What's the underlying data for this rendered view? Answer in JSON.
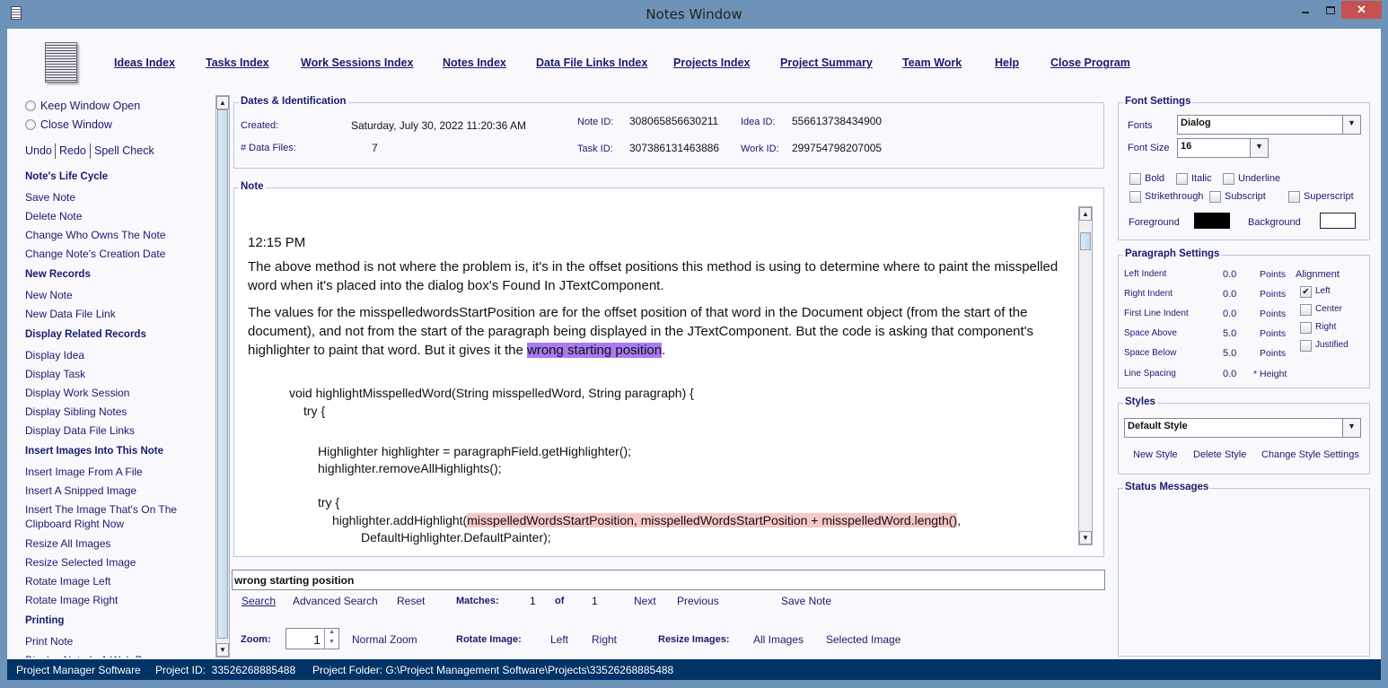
{
  "window": {
    "title": "Notes Window",
    "minimize_icon": "minimize-icon",
    "maximize_icon": "maximize-icon",
    "close_icon": "close-icon",
    "close_color": "#c75050"
  },
  "nav": [
    "Ideas Index",
    "Tasks Index",
    "Work Sessions Index",
    "Notes Index",
    "Data File Links Index",
    "Projects Index",
    "Project Summary",
    "Team Work",
    "Help",
    "Close Program"
  ],
  "sidebar": {
    "radios": [
      "Keep Window Open",
      "Close Window"
    ],
    "edit": [
      "Undo",
      "Redo",
      "Spell Check"
    ],
    "sections": [
      {
        "title": "Note's Life Cycle",
        "items": [
          "Save Note",
          "Delete Note",
          "Change Who Owns The Note",
          "Change Note's Creation Date"
        ]
      },
      {
        "title": "New Records",
        "items": [
          "New Note",
          "New Data File Link"
        ]
      },
      {
        "title": "Display Related Records",
        "items": [
          "Display Idea",
          "Display Task",
          "Display Work Session",
          "Display Sibling Notes",
          "Display Data File Links"
        ]
      },
      {
        "title": "Insert Images Into This Note",
        "items": [
          "Insert Image From A File",
          "Insert A Snipped Image",
          "Insert The Image That's On The Clipboard Right Now",
          "Resize All Images",
          "Resize Selected Image",
          "Rotate Image Left",
          "Rotate Image Right"
        ]
      },
      {
        "title": "Printing",
        "items": [
          "Print Note",
          "Display Note In A Web Page"
        ]
      }
    ]
  },
  "dates": {
    "title": "Dates & Identification",
    "created_label": "Created:",
    "created": "Saturday, July 30, 2022   11:20:36 AM",
    "files_label": "# Data Files:",
    "files": "7",
    "note_id_label": "Note ID:",
    "note_id": "308065856630211",
    "idea_id_label": "Idea ID:",
    "idea_id": "556613738434900",
    "task_id_label": "Task ID:",
    "task_id": "307386131463886",
    "work_id_label": "Work ID:",
    "work_id": "299754798207005"
  },
  "note": {
    "title": "Note",
    "time": "12:15 PM",
    "p1": "The above method is not where the problem is, it's in the offset positions this method is using to determine where to paint the misspelled word when it's placed into the dialog box's Found In JTextComponent.",
    "p2a": "The values for the misspelledwordsStartPosition are for the offset position of that word in the Document object (from the start of the document), and not from the start of the paragraph being displayed in the JTextComponent. But the code is  asking that component's highlighter to paint that word. But it gives it the ",
    "p2hl": "wrong starting position",
    "p2b": ".",
    "code": [
      "void highlightMisspelledWord(String misspelledWord, String paragraph) {",
      "try {",
      "Highlighter highlighter = paragraphField.getHighlighter();",
      "highlighter.removeAllHighlights();",
      "try {",
      "highlighter.addHighlight(",
      "misspelledWordsStartPosition, misspelledWordsStartPosition + misspelledWord.length()",
      ",",
      "DefaultHighlighter.DefaultPainter);"
    ],
    "highlight_color": "#a87cf0",
    "code_highlight_color": "#f8c8c8"
  },
  "search": {
    "value": "wrong starting position",
    "search": "Search",
    "advanced": "Advanced Search",
    "reset": "Reset",
    "matches_label": "Matches:",
    "match": "1",
    "of": "of",
    "total": "1",
    "next": "Next",
    "previous": "Previous",
    "save": "Save Note"
  },
  "bottom": {
    "zoom_label": "Zoom:",
    "zoom": "1",
    "normal_zoom": "Normal Zoom",
    "rotate_label": "Rotate Image:",
    "left": "Left",
    "right": "Right",
    "resize_label": "Resize Images:",
    "all": "All Images",
    "selected": "Selected Image"
  },
  "font": {
    "title": "Font Settings",
    "fonts_label": "Fonts",
    "font": "Dialog",
    "size_label": "Font Size",
    "size": "16",
    "checks": [
      "Bold",
      "Italic",
      "Underline",
      "Strikethrough",
      "Subscript",
      "Superscript"
    ],
    "fg_label": "Foreground",
    "bg_label": "Background",
    "fg": "#000000",
    "bg": "#ffffff"
  },
  "para": {
    "title": "Paragraph Settings",
    "rows": [
      {
        "label": "Left Indent",
        "value": "0.0",
        "unit": "Points"
      },
      {
        "label": "Right Indent",
        "value": "0.0",
        "unit": "Points"
      },
      {
        "label": "First Line Indent",
        "value": "0.0",
        "unit": "Points"
      },
      {
        "label": "Space Above",
        "value": "5.0",
        "unit": "Points"
      },
      {
        "label": "Space Below",
        "value": "5.0",
        "unit": "Points"
      },
      {
        "label": "Line Spacing",
        "value": "0.0",
        "unit": "* Height"
      }
    ],
    "align_label": "Alignment",
    "align": [
      {
        "label": "Left",
        "checked": true
      },
      {
        "label": "Center",
        "checked": false
      },
      {
        "label": "Right",
        "checked": false
      },
      {
        "label": "Justified",
        "checked": false
      }
    ]
  },
  "styles": {
    "title": "Styles",
    "value": "Default Style",
    "new": "New Style",
    "delete": "Delete Style",
    "change": "Change Style Settings"
  },
  "status_messages": {
    "title": "Status Messages"
  },
  "statusbar": {
    "app": "Project Manager Software",
    "project_id": "Project ID:  33526268885488",
    "folder": "Project Folder: G:\\Project Management Software\\Projects\\33526268885488"
  }
}
